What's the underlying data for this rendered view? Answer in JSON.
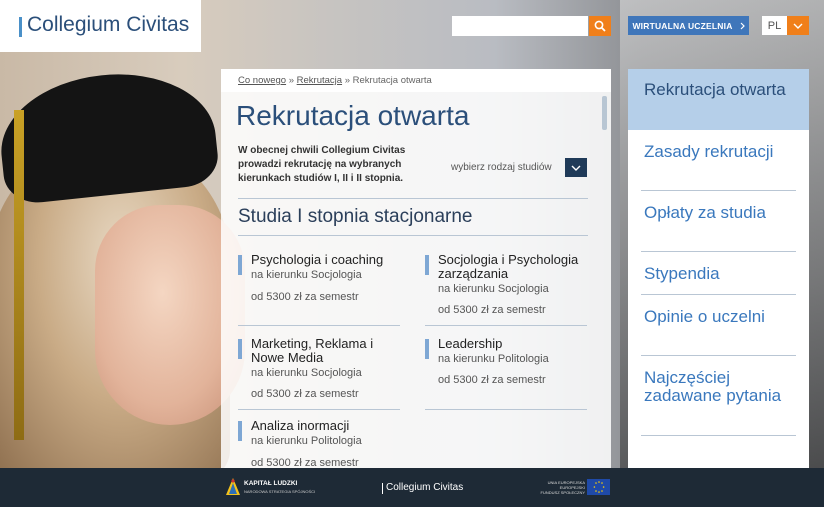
{
  "header": {
    "logo_text": "Collegium Civitas",
    "search": {
      "placeholder": "",
      "value": ""
    },
    "virtual_button": "WIRTUALNA UCZELNIA",
    "language": "PL"
  },
  "breadcrumb": {
    "items": [
      "Co nowego",
      "Rekrutacja",
      "Rekrutacja otwarta"
    ],
    "separator": "»"
  },
  "main": {
    "title": "Rekrutacja otwarta",
    "intro": "W obecnej chwili Collegium Civitas prowadzi rekrutację na wybranych kierunkach studiów I, II i II stopnia.",
    "study_select_label": "wybierz rodzaj studiów",
    "section_title": "Studia I stopnia stacjonarne",
    "courses": [
      {
        "name": "Psychologia i coaching",
        "field": "na kierunku Socjologia",
        "price": "od 5300 zł za semestr"
      },
      {
        "name": "Socjologia i Psychologia zarządzania",
        "field": "na kierunku Socjologia",
        "price": "od 5300 zł za semestr"
      },
      {
        "name": "Marketing, Reklama i Nowe Media",
        "field": "na kierunku Socjologia",
        "price": "od 5300 zł za semestr"
      },
      {
        "name": "Leadership",
        "field": "na kierunku Politologia",
        "price": "od 5300 zł za semestr"
      },
      {
        "name": "Analiza inormacji",
        "field": "na kierunku Politologia",
        "price": "od 5300 zł za semestr"
      }
    ]
  },
  "sidebar": {
    "items": [
      {
        "label": "Rekrutacja otwarta",
        "active": true
      },
      {
        "label": "Zasady rekrutacji"
      },
      {
        "label": "Opłaty za studia"
      },
      {
        "label": "Stypendia"
      },
      {
        "label": "Opinie o uczelni"
      },
      {
        "label": "Najczęściej zadawane pytania"
      }
    ]
  },
  "footer": {
    "kl_title": "KAPITAŁ LUDZKI",
    "kl_subtitle": "NARODOWA STRATEGIA SPÓJNOŚCI",
    "name": "Collegium Civitas",
    "eu_text": "UNIA EUROPEJSKA EUROPEJSKI FUNDUSZ SPOŁECZNY"
  },
  "colors": {
    "accent_orange": "#f07f1a",
    "brand_blue": "#3f76ba",
    "title_blue": "#2b4f7a",
    "footer_bg": "#1e2a36",
    "nav_active_bg": "#b5cfe9"
  },
  "icons": {
    "search": "search-icon",
    "virtual_arrow": "chevron-right-icon",
    "lang_arrow": "chevron-down-icon",
    "select_arrow": "chevron-down-icon"
  }
}
